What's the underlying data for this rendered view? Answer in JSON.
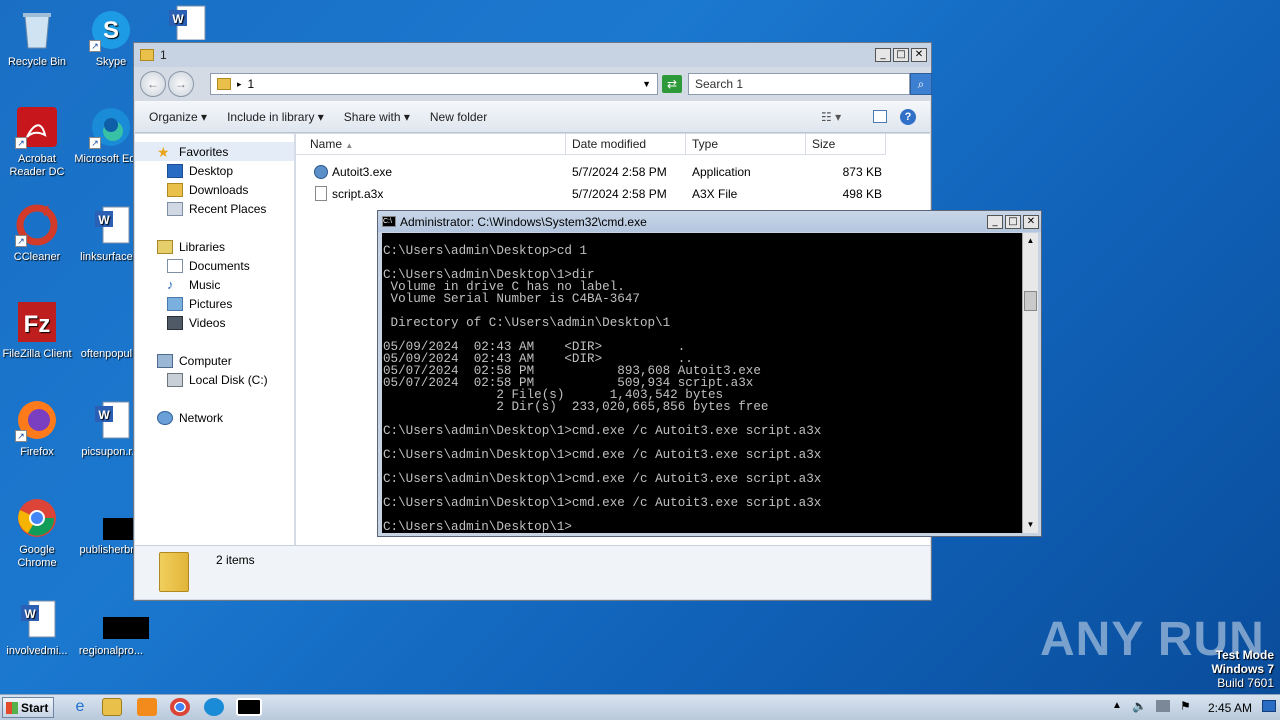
{
  "desktop": {
    "icons": [
      {
        "label": "Recycle Bin"
      },
      {
        "label": "Skype"
      },
      {
        "label": "Acrobat Reader DC"
      },
      {
        "label": "Microsoft Edge"
      },
      {
        "label": "CCleaner"
      },
      {
        "label": "linksurface..."
      },
      {
        "label": "FileZilla Client"
      },
      {
        "label": "oftenpopul..."
      },
      {
        "label": "Firefox"
      },
      {
        "label": "picsupon.r..."
      },
      {
        "label": "Google Chrome"
      },
      {
        "label": "publisherbr..."
      },
      {
        "label": "involvedmi..."
      },
      {
        "label": "regionalpro..."
      }
    ]
  },
  "explorer": {
    "title": "1",
    "address": "1",
    "search_placeholder": "Search 1",
    "toolbar": {
      "organize": "Organize",
      "include": "Include in library",
      "share": "Share with",
      "newfolder": "New folder"
    },
    "nav": {
      "favorites": "Favorites",
      "desktop": "Desktop",
      "downloads": "Downloads",
      "recent": "Recent Places",
      "libraries": "Libraries",
      "documents": "Documents",
      "music": "Music",
      "pictures": "Pictures",
      "videos": "Videos",
      "computer": "Computer",
      "localdisk": "Local Disk (C:)",
      "network": "Network"
    },
    "columns": {
      "name": "Name",
      "date": "Date modified",
      "type": "Type",
      "size": "Size"
    },
    "files": [
      {
        "name": "Autoit3.exe",
        "date": "5/7/2024 2:58 PM",
        "type": "Application",
        "size": "873 KB"
      },
      {
        "name": "script.a3x",
        "date": "5/7/2024 2:58 PM",
        "type": "A3X File",
        "size": "498 KB"
      }
    ],
    "status": "2 items"
  },
  "cmd": {
    "title": "Administrator: C:\\Windows\\System32\\cmd.exe",
    "lines": [
      "",
      "C:\\Users\\admin\\Desktop>cd 1",
      "",
      "C:\\Users\\admin\\Desktop\\1>dir",
      " Volume in drive C has no label.",
      " Volume Serial Number is C4BA-3647",
      "",
      " Directory of C:\\Users\\admin\\Desktop\\1",
      "",
      "05/09/2024  02:43 AM    <DIR>          .",
      "05/09/2024  02:43 AM    <DIR>          ..",
      "05/07/2024  02:58 PM           893,608 Autoit3.exe",
      "05/07/2024  02:58 PM           509,934 script.a3x",
      "               2 File(s)      1,403,542 bytes",
      "               2 Dir(s)  233,020,665,856 bytes free",
      "",
      "C:\\Users\\admin\\Desktop\\1>cmd.exe /c Autoit3.exe script.a3x",
      "",
      "C:\\Users\\admin\\Desktop\\1>cmd.exe /c Autoit3.exe script.a3x",
      "",
      "C:\\Users\\admin\\Desktop\\1>cmd.exe /c Autoit3.exe script.a3x",
      "",
      "C:\\Users\\admin\\Desktop\\1>cmd.exe /c Autoit3.exe script.a3x",
      "",
      "C:\\Users\\admin\\Desktop\\1>"
    ]
  },
  "taskbar": {
    "start": "Start",
    "clock": "2:45 AM"
  },
  "watermark": "ANY RUN",
  "testmode": {
    "line1": "Test Mode",
    "line2": "Windows 7",
    "line3": "Build 7601"
  }
}
